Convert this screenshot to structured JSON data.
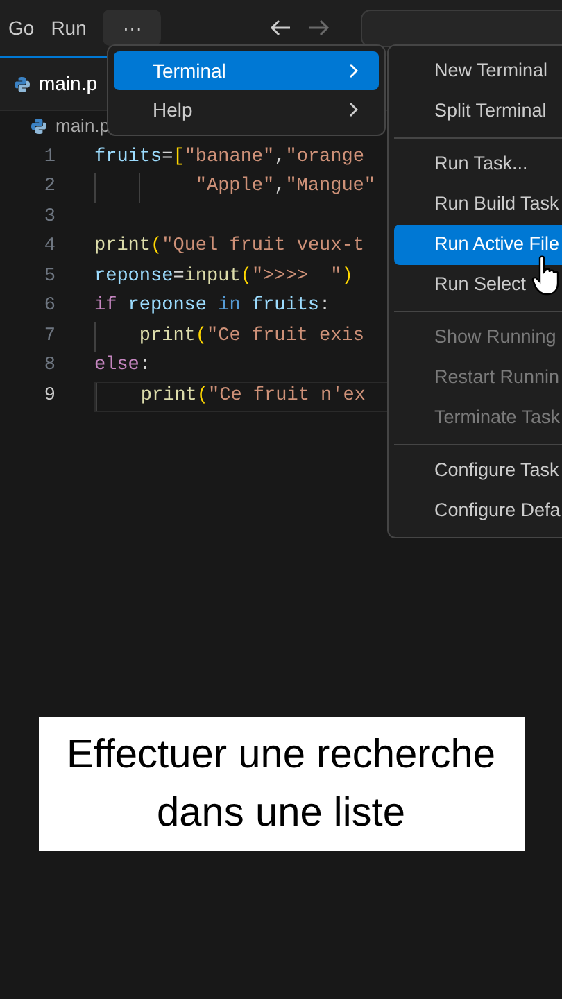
{
  "menubar": [
    {
      "label": "Go"
    },
    {
      "label": "Run"
    }
  ],
  "more_button": {
    "label": "···"
  },
  "tab": {
    "label": "main.p"
  },
  "breadcrumb": {
    "label": "main.p"
  },
  "editor": {
    "lines": [
      {
        "number": "1",
        "current": false,
        "tokens": [
          {
            "t": "fruits",
            "kind": "var"
          },
          {
            "t": "=",
            "kind": "punct"
          },
          {
            "t": "[",
            "kind": "bracket"
          },
          {
            "t": "\"banane\"",
            "kind": "str"
          },
          {
            "t": ",",
            "kind": "punct"
          },
          {
            "t": "\"orange",
            "kind": "str"
          }
        ]
      },
      {
        "number": "2",
        "current": false,
        "tokens": [
          {
            "kind": "guide"
          },
          {
            "kind": "guide"
          },
          {
            "t": " \"Apple\"",
            "kind": "str"
          },
          {
            "t": ",",
            "kind": "punct"
          },
          {
            "t": "\"Mangue\"",
            "kind": "str"
          }
        ]
      },
      {
        "number": "3",
        "current": false
      },
      {
        "number": "4",
        "current": false,
        "tokens": [
          {
            "t": "print",
            "kind": "func"
          },
          {
            "t": "(",
            "kind": "bracket"
          },
          {
            "t": "\"Quel fruit veux-t",
            "kind": "str"
          }
        ]
      },
      {
        "number": "5",
        "current": false,
        "tokens": [
          {
            "t": "reponse",
            "kind": "var"
          },
          {
            "t": "=",
            "kind": "punct"
          },
          {
            "t": "input",
            "kind": "func"
          },
          {
            "t": "(",
            "kind": "bracket"
          },
          {
            "t": "\">>>>  \"",
            "kind": "str"
          },
          {
            "t": ")",
            "kind": "bracket"
          }
        ]
      },
      {
        "number": "6",
        "current": false,
        "tokens": [
          {
            "t": "if",
            "kind": "control"
          },
          {
            "t": " reponse ",
            "kind": "var"
          },
          {
            "t": "in",
            "kind": "keyword"
          },
          {
            "t": " fruits",
            "kind": "var"
          },
          {
            "t": ":",
            "kind": "punct"
          }
        ]
      },
      {
        "number": "7",
        "current": false,
        "tokens": [
          {
            "kind": "guide"
          },
          {
            "t": "print",
            "kind": "func"
          },
          {
            "t": "(",
            "kind": "bracket"
          },
          {
            "t": "\"Ce fruit exis",
            "kind": "str"
          }
        ]
      },
      {
        "number": "8",
        "current": false,
        "tokens": [
          {
            "t": "else",
            "kind": "control"
          },
          {
            "t": ":",
            "kind": "punct"
          }
        ]
      },
      {
        "number": "9",
        "current": true,
        "tokens": [
          {
            "kind": "guide"
          },
          {
            "t": "print",
            "kind": "func"
          },
          {
            "t": "(",
            "kind": "bracket"
          },
          {
            "t": "\"Ce fruit n'ex",
            "kind": "str"
          }
        ]
      }
    ]
  },
  "menu": {
    "items": [
      {
        "label": "Terminal",
        "selected": true,
        "submenu": true
      },
      {
        "label": "Help",
        "selected": false,
        "submenu": true
      }
    ]
  },
  "submenu": {
    "groups": [
      [
        {
          "label": "New Terminal",
          "selected": false,
          "disabled": false
        },
        {
          "label": "Split Terminal",
          "selected": false,
          "disabled": false
        }
      ],
      [
        {
          "label": "Run Task...",
          "selected": false,
          "disabled": false
        },
        {
          "label": "Run Build Task",
          "selected": false,
          "disabled": false
        },
        {
          "label": "Run Active File",
          "selected": true,
          "disabled": false
        },
        {
          "label": "Run Select",
          "selected": false,
          "disabled": false
        }
      ],
      [
        {
          "label": "Show Running",
          "selected": false,
          "disabled": true
        },
        {
          "label": "Restart Runnin",
          "selected": false,
          "disabled": true
        },
        {
          "label": "Terminate Task",
          "selected": false,
          "disabled": true
        }
      ],
      [
        {
          "label": "Configure Task",
          "selected": false,
          "disabled": false
        },
        {
          "label": "Configure Defa",
          "selected": false,
          "disabled": false
        }
      ]
    ]
  },
  "caption": {
    "lines": [
      "Effectuer une recherche",
      "dans une liste"
    ]
  }
}
